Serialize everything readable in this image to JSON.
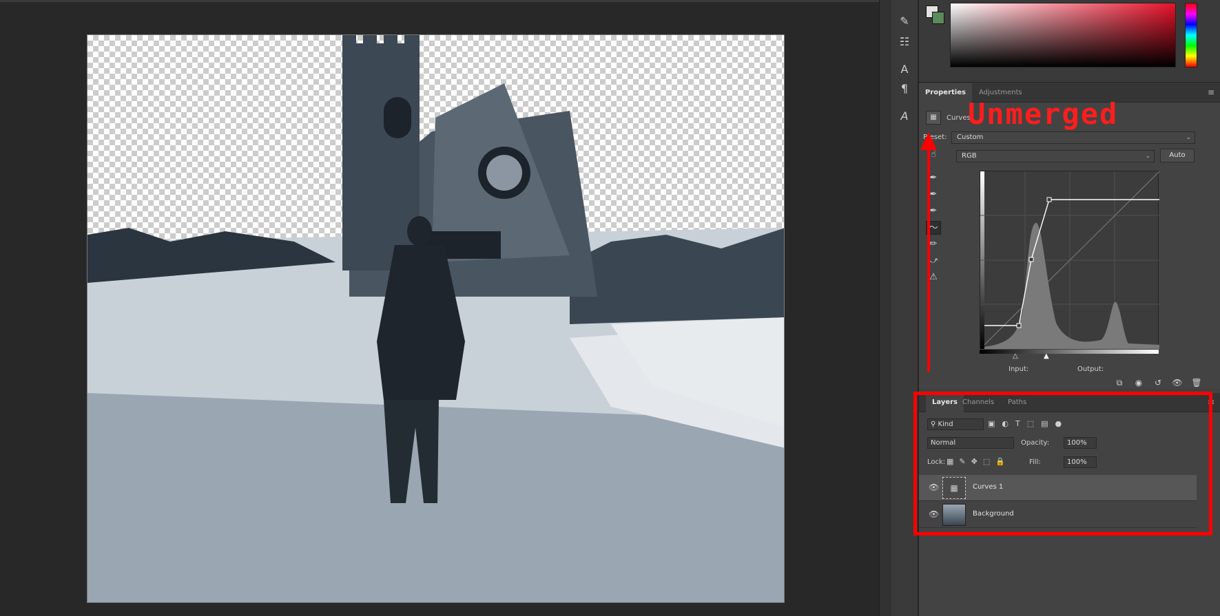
{
  "properties_panel": {
    "tabs": [
      "Properties",
      "Adjustments"
    ],
    "adjustment_name": "Curves",
    "preset_label": "Preset:",
    "preset_value": "Custom",
    "channel_value": "RGB",
    "auto_button": "Auto",
    "input_label": "Input:",
    "output_label": "Output:"
  },
  "layers_panel": {
    "tabs": [
      "Layers",
      "Channels",
      "Paths"
    ],
    "filter_kind": "Kind",
    "blend_mode": "Normal",
    "opacity_label": "Opacity:",
    "opacity_value": "100%",
    "lock_label": "Lock:",
    "fill_label": "Fill:",
    "fill_value": "100%",
    "layers": [
      {
        "name": "Curves 1",
        "selected": true
      },
      {
        "name": "Background",
        "selected": false
      }
    ]
  },
  "annotation": {
    "text": "Unmerged",
    "color": "#ff1d1d"
  },
  "colors": {
    "accent_red": "#ff0000",
    "panel_bg": "#434343",
    "canvas_bg": "#282828"
  },
  "icons": {
    "toolbar": [
      "brush-settings-icon",
      "adjust-icon",
      "character-icon",
      "paragraph-icon",
      "glyph-icon"
    ],
    "curve_tools": [
      "target-adjust-icon",
      "eyedropper-black-icon",
      "eyedropper-gray-icon",
      "eyedropper-white-icon",
      "curve-point-icon",
      "pencil-icon",
      "smooth-icon",
      "clipping-warning-icon"
    ],
    "props_bottom": [
      "clip-to-layer-icon",
      "view-previous-icon",
      "reset-icon",
      "visibility-icon",
      "delete-icon"
    ]
  }
}
